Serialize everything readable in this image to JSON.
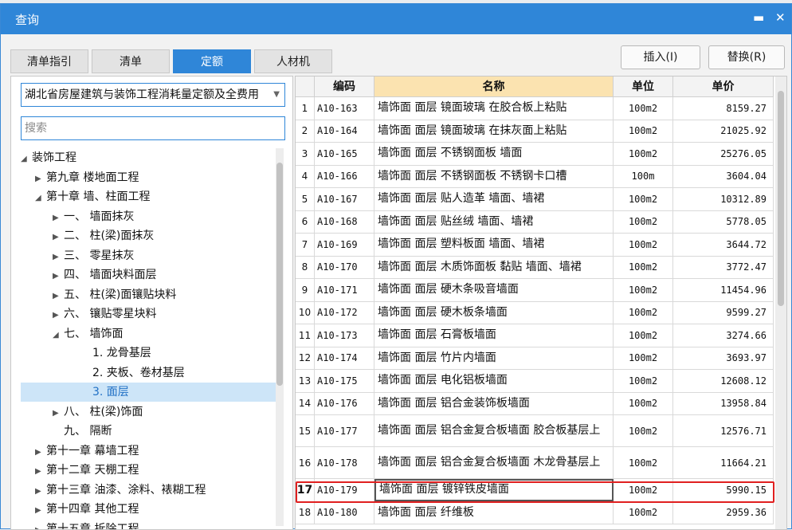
{
  "window": {
    "title": "查询",
    "minimize_icon": "minimize-icon",
    "close_icon": "close-icon",
    "minimize_glyph": "▬",
    "close_glyph": "✕"
  },
  "tabs": [
    {
      "label": "清单指引"
    },
    {
      "label": "清单"
    },
    {
      "label": "定额",
      "active": true
    },
    {
      "label": "人材机"
    }
  ],
  "actions": {
    "insert_label": "插入(I)",
    "replace_label": "替换(R)"
  },
  "left": {
    "dropdown_value": "湖北省房屋建筑与装饰工程消耗量定额及全费用",
    "search_placeholder": "搜索",
    "tree": [
      {
        "label": "装饰工程",
        "level": 0,
        "expanded": true
      },
      {
        "label": "第九章 楼地面工程",
        "level": 1,
        "expanded": false
      },
      {
        "label": "第十章 墙、柱面工程",
        "level": 1,
        "expanded": true
      },
      {
        "label": "一、 墙面抹灰",
        "level": 2,
        "expanded": false
      },
      {
        "label": "二、 柱(梁)面抹灰",
        "level": 2,
        "expanded": false
      },
      {
        "label": "三、 零星抹灰",
        "level": 2,
        "expanded": false
      },
      {
        "label": "四、 墙面块料面层",
        "level": 2,
        "expanded": false
      },
      {
        "label": "五、 柱(梁)面镶贴块料",
        "level": 2,
        "expanded": false
      },
      {
        "label": "六、 镶贴零星块料",
        "level": 2,
        "expanded": false
      },
      {
        "label": "七、 墙饰面",
        "level": 2,
        "expanded": true
      },
      {
        "label": "1. 龙骨基层",
        "level": 3
      },
      {
        "label": "2. 夹板、卷材基层",
        "level": 3
      },
      {
        "label": "3. 面层",
        "level": 3,
        "selected": true
      },
      {
        "label": "八、 柱(梁)饰面",
        "level": 2,
        "expanded": false
      },
      {
        "label": "九、 隔断",
        "level": 2
      },
      {
        "label": "第十一章 幕墙工程",
        "level": 1,
        "expanded": false
      },
      {
        "label": "第十二章 天棚工程",
        "level": 1,
        "expanded": false
      },
      {
        "label": "第十三章 油漆、涂料、裱糊工程",
        "level": 1,
        "expanded": false
      },
      {
        "label": "第十四章 其他工程",
        "level": 1,
        "expanded": false
      },
      {
        "label": "第十五章 拆除工程",
        "level": 1,
        "expanded": false
      }
    ]
  },
  "table": {
    "headers": {
      "code": "编码",
      "name": "名称",
      "unit": "单位",
      "price": "单价"
    },
    "rows": [
      {
        "idx": "1",
        "code": "A10-163",
        "name": "墙饰面 面层 镜面玻璃 在胶合板上粘贴",
        "unit": "100m2",
        "price": "8159.27"
      },
      {
        "idx": "2",
        "code": "A10-164",
        "name": "墙饰面 面层 镜面玻璃 在抹灰面上粘贴",
        "unit": "100m2",
        "price": "21025.92"
      },
      {
        "idx": "3",
        "code": "A10-165",
        "name": "墙饰面 面层 不锈钢面板 墙面",
        "unit": "100m2",
        "price": "25276.05"
      },
      {
        "idx": "4",
        "code": "A10-166",
        "name": "墙饰面 面层 不锈钢面板 不锈钢卡口槽",
        "unit": "100m",
        "price": "3604.04"
      },
      {
        "idx": "5",
        "code": "A10-167",
        "name": "墙饰面 面层 贴人造革 墙面、墙裙",
        "unit": "100m2",
        "price": "10312.89"
      },
      {
        "idx": "6",
        "code": "A10-168",
        "name": "墙饰面 面层 贴丝绒 墙面、墙裙",
        "unit": "100m2",
        "price": "5778.05"
      },
      {
        "idx": "7",
        "code": "A10-169",
        "name": "墙饰面 面层 塑料板面 墙面、墙裙",
        "unit": "100m2",
        "price": "3644.72"
      },
      {
        "idx": "8",
        "code": "A10-170",
        "name": "墙饰面 面层 木质饰面板 黏贴 墙面、墙裙",
        "unit": "100m2",
        "price": "3772.47"
      },
      {
        "idx": "9",
        "code": "A10-171",
        "name": "墙饰面 面层 硬木条吸音墙面",
        "unit": "100m2",
        "price": "11454.96"
      },
      {
        "idx": "10",
        "code": "A10-172",
        "name": "墙饰面 面层 硬木板条墙面",
        "unit": "100m2",
        "price": "9599.27"
      },
      {
        "idx": "11",
        "code": "A10-173",
        "name": "墙饰面 面层 石膏板墙面",
        "unit": "100m2",
        "price": "3274.66"
      },
      {
        "idx": "12",
        "code": "A10-174",
        "name": "墙饰面 面层 竹片内墙面",
        "unit": "100m2",
        "price": "3693.97"
      },
      {
        "idx": "13",
        "code": "A10-175",
        "name": "墙饰面 面层 电化铝板墙面",
        "unit": "100m2",
        "price": "12608.12"
      },
      {
        "idx": "14",
        "code": "A10-176",
        "name": "墙饰面 面层 铝合金装饰板墙面",
        "unit": "100m2",
        "price": "13958.84"
      },
      {
        "idx": "15",
        "code": "A10-177",
        "name": "墙饰面 面层 铝合金复合板墙面 胶合板基层上",
        "unit": "100m2",
        "price": "12576.71",
        "tall": true
      },
      {
        "idx": "16",
        "code": "A10-178",
        "name": "墙饰面 面层 铝合金复合板墙面 木龙骨基层上",
        "unit": "100m2",
        "price": "11664.21",
        "tall": true
      },
      {
        "idx": "17",
        "code": "A10-179",
        "name": "墙饰面 面层 镀锌铁皮墙面",
        "unit": "100m2",
        "price": "5990.15",
        "highlighted": true
      },
      {
        "idx": "18",
        "code": "A10-180",
        "name": "墙饰面 面层 纤维板",
        "unit": "100m2",
        "price": "2959.36"
      }
    ]
  },
  "colors": {
    "accent": "#2f86d8",
    "highlight_border": "#e02020",
    "selected_bg": "#cde5f8",
    "name_header_bg": "#fbe3b0"
  }
}
